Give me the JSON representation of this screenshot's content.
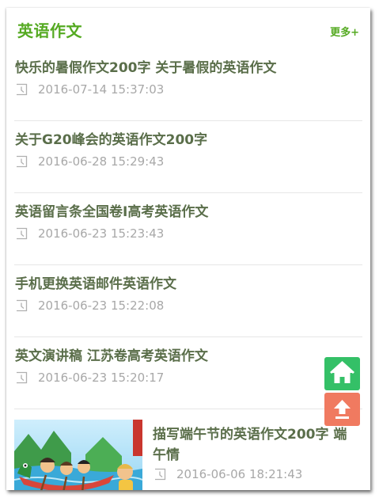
{
  "header": {
    "title": "英语作文",
    "more_label": "更多+"
  },
  "articles": [
    {
      "title": "快乐的暑假作文200字 关于暑假的英语作文",
      "time": "2016-07-14 15:37:03"
    },
    {
      "title": "关于G20峰会的英语作文200字",
      "time": "2016-06-28 15:29:43"
    },
    {
      "title": "英语留言条全国卷I高考英语作文",
      "time": "2016-06-23 15:23:43"
    },
    {
      "title": "手机更换英语邮件英语作文",
      "time": "2016-06-23 15:22:08"
    },
    {
      "title": "英文演讲稿 江苏卷高考英语作文",
      "time": "2016-06-23 15:20:17"
    }
  ],
  "featured": {
    "title": "描写端午节的英语作文200字 端午情",
    "time": "2016-06-06 18:21:43",
    "image_icon": "dragon-boat-illustration"
  },
  "floating": {
    "home_icon": "home-icon",
    "top_icon": "back-to-top-icon"
  },
  "colors": {
    "accent": "#55aa22",
    "title_text": "#5a6e4a",
    "meta_text": "#a8a8a8",
    "home_button": "#34c067",
    "top_button": "#f07a60"
  }
}
